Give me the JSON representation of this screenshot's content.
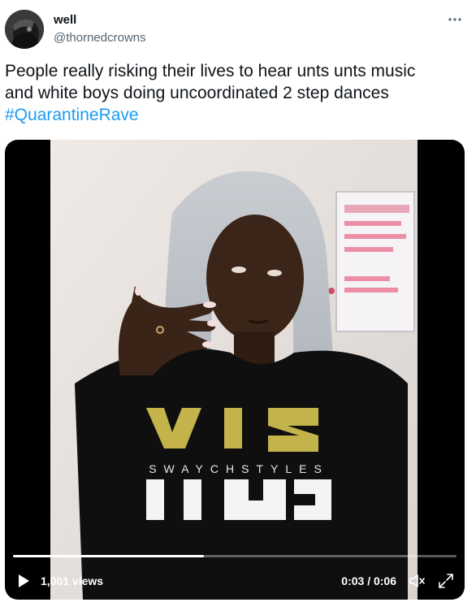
{
  "author": {
    "display_name": "well",
    "handle": "@thornedcrowns"
  },
  "tweet": {
    "text_line1": "People really risking their lives to hear unts unts music",
    "text_line2": "and white boys doing uncoordinated 2 step dances",
    "hashtag": "#QuarantineRave"
  },
  "video": {
    "views": "1,001 views",
    "time": "0:03 / 0:06",
    "progress_fraction": 0.43,
    "shirt_text": "SWAYCHSTYLES"
  },
  "icons": {
    "more": "more-horizontal-icon",
    "play": "play-icon",
    "volume": "volume-muted-icon",
    "fullscreen": "fullscreen-icon"
  },
  "colors": {
    "link": "#1d9bf0",
    "text": "#0f1419",
    "secondary": "#536471"
  }
}
